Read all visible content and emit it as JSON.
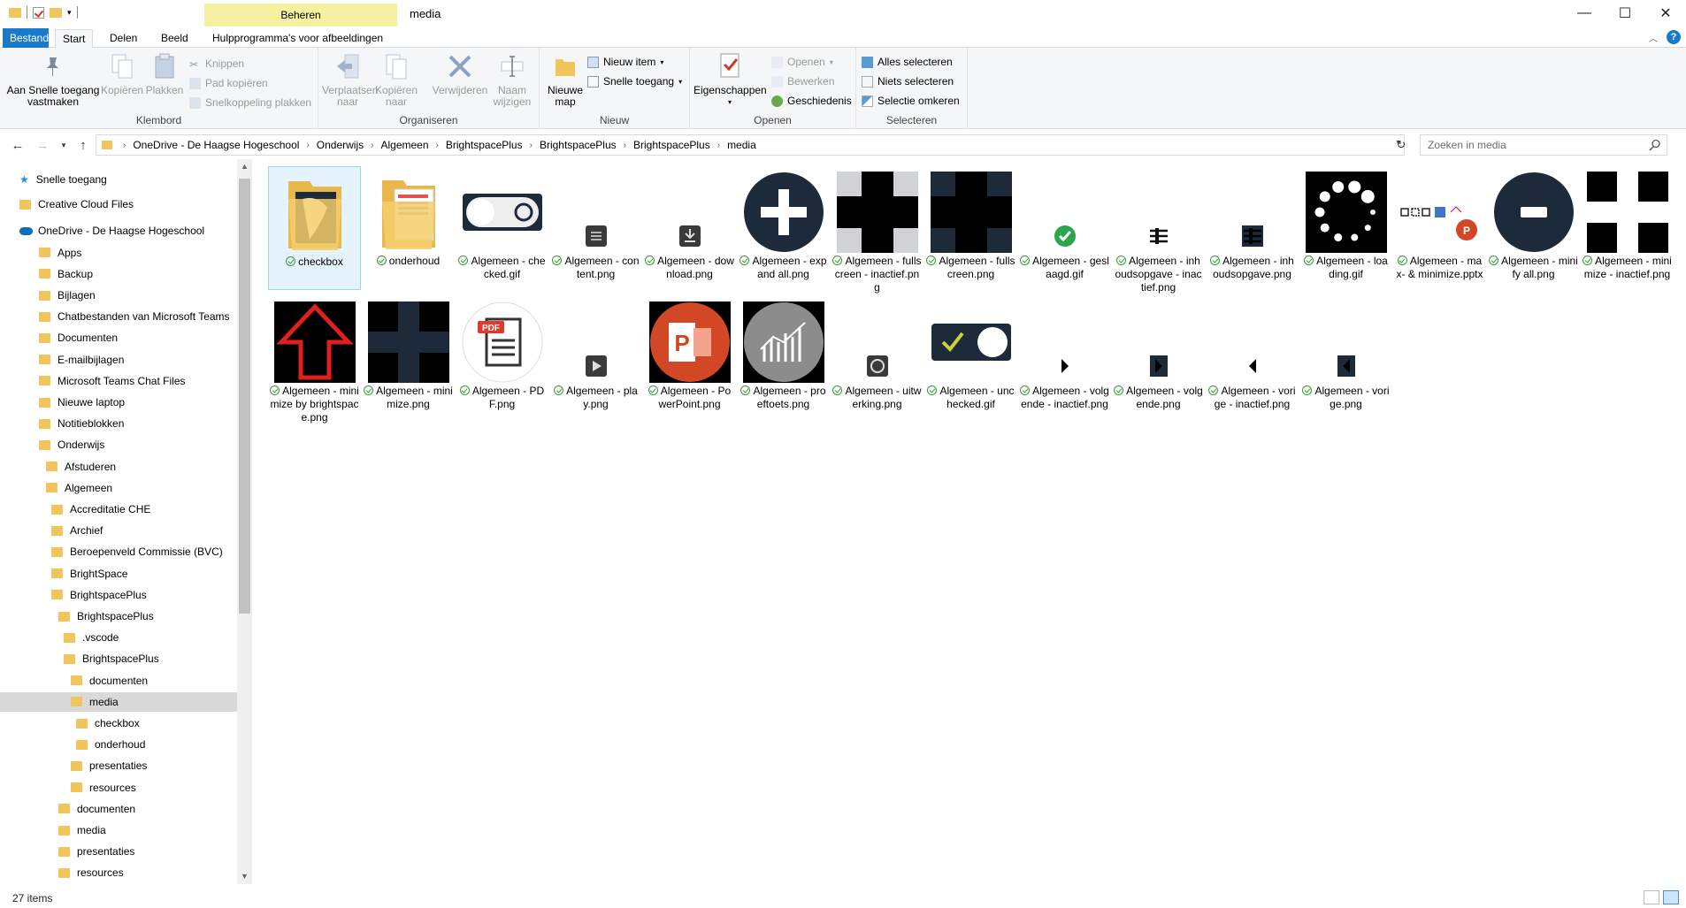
{
  "window": {
    "title": "media",
    "context_tab": "Beheren",
    "context_color": "#f6f1a0"
  },
  "ribbon_tabs": {
    "file": "Bestand",
    "start": "Start",
    "share": "Delen",
    "view": "Beeld",
    "picture_tools": "Hulpprogramma's voor afbeeldingen"
  },
  "ribbon": {
    "klembord": {
      "title": "Klembord",
      "pin": "Aan Snelle toegang vastmaken",
      "copy": "Kopiëren",
      "paste": "Plakken",
      "cut": "Knippen",
      "copy_path": "Pad kopiëren",
      "paste_shortcut": "Snelkoppeling plakken"
    },
    "organiseren": {
      "title": "Organiseren",
      "move": "Verplaatsen naar",
      "copy_to": "Kopiëren naar",
      "delete": "Verwijderen",
      "rename": "Naam wijzigen"
    },
    "nieuw": {
      "title": "Nieuw",
      "new_folder": "Nieuwe map",
      "new_item": "Nieuw item",
      "easy_access": "Snelle toegang"
    },
    "openen": {
      "title": "Openen",
      "properties": "Eigenschappen",
      "open": "Openen",
      "edit": "Bewerken",
      "history": "Geschiedenis"
    },
    "selecteren": {
      "title": "Selecteren",
      "select_all": "Alles selecteren",
      "select_none": "Niets selecteren",
      "invert": "Selectie omkeren"
    }
  },
  "address": {
    "crumbs": [
      "OneDrive - De Haagse Hogeschool",
      "Onderwijs",
      "Algemeen",
      "BrightspacePlus",
      "BrightspacePlus",
      "BrightspacePlus",
      "media"
    ],
    "search_placeholder": "Zoeken in media"
  },
  "nav": [
    {
      "label": "Snelle toegang",
      "icon": "star-icon",
      "indent": 0
    },
    {
      "label": "Creative Cloud Files",
      "icon": "creative-cloud-icon",
      "indent": 0
    },
    {
      "label": "OneDrive - De Haagse Hogeschool",
      "icon": "onedrive-icon",
      "indent": 0
    },
    {
      "label": "Apps",
      "indent": 1
    },
    {
      "label": "Backup",
      "indent": 1
    },
    {
      "label": "Bijlagen",
      "indent": 1
    },
    {
      "label": "Chatbestanden van Microsoft Teams",
      "indent": 1
    },
    {
      "label": "Documenten",
      "indent": 1
    },
    {
      "label": "E-mailbijlagen",
      "indent": 1
    },
    {
      "label": "Microsoft Teams Chat Files",
      "indent": 1
    },
    {
      "label": "Nieuwe laptop",
      "indent": 1
    },
    {
      "label": "Notitieblokken",
      "indent": 1
    },
    {
      "label": "Onderwijs",
      "indent": 1
    },
    {
      "label": "Afstuderen",
      "indent": 2
    },
    {
      "label": "Algemeen",
      "indent": 2
    },
    {
      "label": "Accreditatie CHE",
      "indent": 3
    },
    {
      "label": "Archief",
      "indent": 3
    },
    {
      "label": "Beroepenveld Commissie (BVC)",
      "indent": 3
    },
    {
      "label": "BrightSpace",
      "indent": 3
    },
    {
      "label": "BrightspacePlus",
      "indent": 3
    },
    {
      "label": "BrightspacePlus",
      "indent": 4
    },
    {
      "label": ".vscode",
      "indent": 5
    },
    {
      "label": "BrightspacePlus",
      "indent": 5
    },
    {
      "label": "documenten",
      "indent": 6
    },
    {
      "label": "media",
      "indent": 6,
      "selected": true
    },
    {
      "label": "checkbox",
      "indent": 7
    },
    {
      "label": "onderhoud",
      "indent": 7
    },
    {
      "label": "presentaties",
      "indent": 6
    },
    {
      "label": "resources",
      "indent": 6
    },
    {
      "label": "documenten",
      "indent": 4
    },
    {
      "label": "media",
      "indent": 4
    },
    {
      "label": "presentaties",
      "indent": 4
    },
    {
      "label": "resources",
      "indent": 4
    }
  ],
  "files": [
    {
      "name": "checkbox",
      "kind": "folder-dark",
      "selected": true
    },
    {
      "name": "onderhoud",
      "kind": "folder-docs"
    },
    {
      "name": "Algemeen - checked.gif",
      "kind": "toggle-off"
    },
    {
      "name": "Algemeen - content.png",
      "kind": "small-list"
    },
    {
      "name": "Algemeen - download.png",
      "kind": "small-download"
    },
    {
      "name": "Algemeen - expand all.png",
      "kind": "plus-circle"
    },
    {
      "name": "Algemeen - fullscreen - inactief.png",
      "kind": "cross-grey"
    },
    {
      "name": "Algemeen - fullscreen.png",
      "kind": "cross-dark"
    },
    {
      "name": "Algemeen - geslaagd.gif",
      "kind": "small-check"
    },
    {
      "name": "Algemeen - inhoudsopgave - inactief.png",
      "kind": "small-toc"
    },
    {
      "name": "Algemeen - inhoudsopgave.png",
      "kind": "small-toc-dark"
    },
    {
      "name": "Algemeen - loading.gif",
      "kind": "loading"
    },
    {
      "name": "Algemeen - max- & minimize.pptx",
      "kind": "pptx-icons"
    },
    {
      "name": "Algemeen - minify all.png",
      "kind": "minus-circle"
    },
    {
      "name": "Algemeen - minimize - inactief.png",
      "kind": "cross-white"
    },
    {
      "name": "Algemeen - minimize by brightspace.png",
      "kind": "red-arrow"
    },
    {
      "name": "Algemeen - minimize.png",
      "kind": "cross-dark2"
    },
    {
      "name": "Algemeen - PDF.png",
      "kind": "pdf"
    },
    {
      "name": "Algemeen - play.png",
      "kind": "small-play"
    },
    {
      "name": "Algemeen - PowerPoint.png",
      "kind": "powerpoint"
    },
    {
      "name": "Algemeen - proeftoets.png",
      "kind": "chart-circle"
    },
    {
      "name": "Algemeen - uitwerking.png",
      "kind": "small-uitwerking"
    },
    {
      "name": "Algemeen - unchecked.gif",
      "kind": "toggle-on"
    },
    {
      "name": "Algemeen - volgende - inactief.png",
      "kind": "small-next-inactive"
    },
    {
      "name": "Algemeen - volgende.png",
      "kind": "small-next"
    },
    {
      "name": "Algemeen - vorige - inactief.png",
      "kind": "small-prev-inactive"
    },
    {
      "name": "Algemeen - vorige.png",
      "kind": "small-prev"
    }
  ],
  "status": {
    "items": "27 items"
  },
  "colors": {
    "accent": "#1979ca",
    "folder": "#f2c55c",
    "selection": "#e5f3ff"
  }
}
